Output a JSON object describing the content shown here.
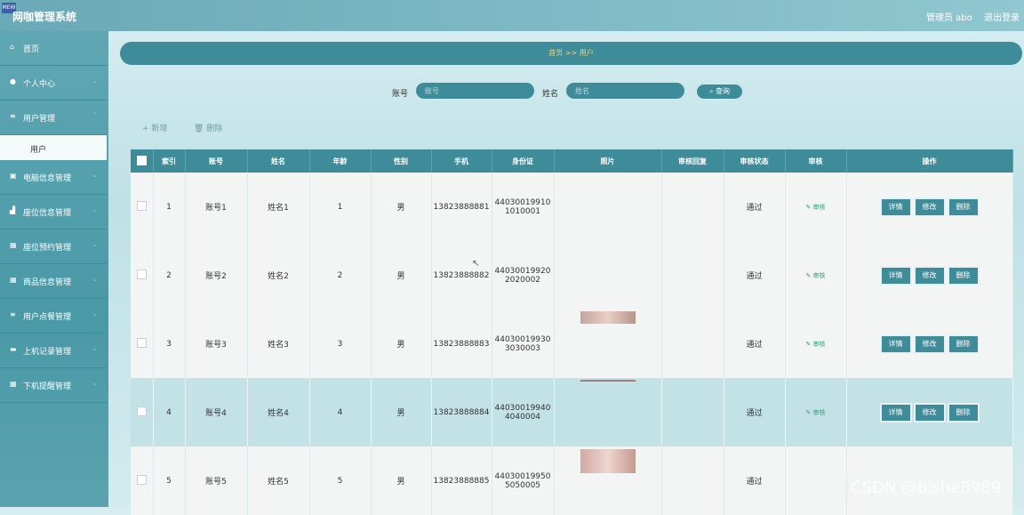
{
  "header": {
    "logo": "MEW",
    "title": "网咖管理系统",
    "admin": "管理员 abo",
    "logout": "退出登录"
  },
  "sidebar": {
    "items": [
      {
        "icon": "home-icon",
        "label": "首页"
      },
      {
        "icon": "user-icon",
        "label": "个人中心"
      },
      {
        "icon": "list-icon",
        "label": "用户管理"
      },
      {
        "icon": "computer-icon",
        "label": "电脑信息管理"
      },
      {
        "icon": "seat-icon",
        "label": "座位信息管理"
      },
      {
        "icon": "grid-icon",
        "label": "座位预约管理"
      },
      {
        "icon": "grid-icon",
        "label": "商品信息管理"
      },
      {
        "icon": "list-icon",
        "label": "用户点餐管理"
      },
      {
        "icon": "monitor-icon",
        "label": "上机记录管理"
      },
      {
        "icon": "grid-icon",
        "label": "下机提醒管理"
      }
    ],
    "submenu": "用户"
  },
  "breadcrumb": "首页 >> 用户",
  "search": {
    "account_label": "账号",
    "account_placeholder": "账号",
    "name_label": "姓名",
    "name_placeholder": "姓名",
    "query_label": "查询"
  },
  "actions": {
    "add": "新增",
    "delete": "删除"
  },
  "table": {
    "headers": [
      "索引",
      "账号",
      "姓名",
      "年龄",
      "性别",
      "手机",
      "身份证",
      "照片",
      "审核回复",
      "审核状态",
      "审核",
      "操作"
    ],
    "rows": [
      {
        "index": "1",
        "account": "账号1",
        "name": "姓名1",
        "age": "1",
        "gender": "男",
        "phone": "13823888881",
        "id1": "44030019910",
        "id2": "1010001",
        "status": "通过",
        "audit": "审核"
      },
      {
        "index": "2",
        "account": "账号2",
        "name": "姓名2",
        "age": "2",
        "gender": "男",
        "phone": "13823888882",
        "id1": "44030019920",
        "id2": "2020002",
        "status": "通过",
        "audit": "审核"
      },
      {
        "index": "3",
        "account": "账号3",
        "name": "姓名3",
        "age": "3",
        "gender": "男",
        "phone": "13823888883",
        "id1": "44030019930",
        "id2": "3030003",
        "status": "通过",
        "audit": "审核"
      },
      {
        "index": "4",
        "account": "账号4",
        "name": "姓名4",
        "age": "4",
        "gender": "男",
        "phone": "13823888884",
        "id1": "44030019940",
        "id2": "4040004",
        "status": "通过",
        "audit": "审核"
      },
      {
        "index": "5",
        "account": "账号5",
        "name": "姓名5",
        "age": "5",
        "gender": "男",
        "phone": "13823888885",
        "id1": "44030019950",
        "id2": "5050005",
        "status": "通过",
        "audit": ""
      }
    ],
    "ops": {
      "detail": "详情",
      "edit": "修改",
      "delete": "删除"
    }
  },
  "watermark": "CSDN @bishe8989",
  "colors": {
    "primary": "#3e8c99",
    "sidebar": "#4a99a7",
    "accent_text": "#f5d36a",
    "audit_link": "#2aa36b"
  }
}
